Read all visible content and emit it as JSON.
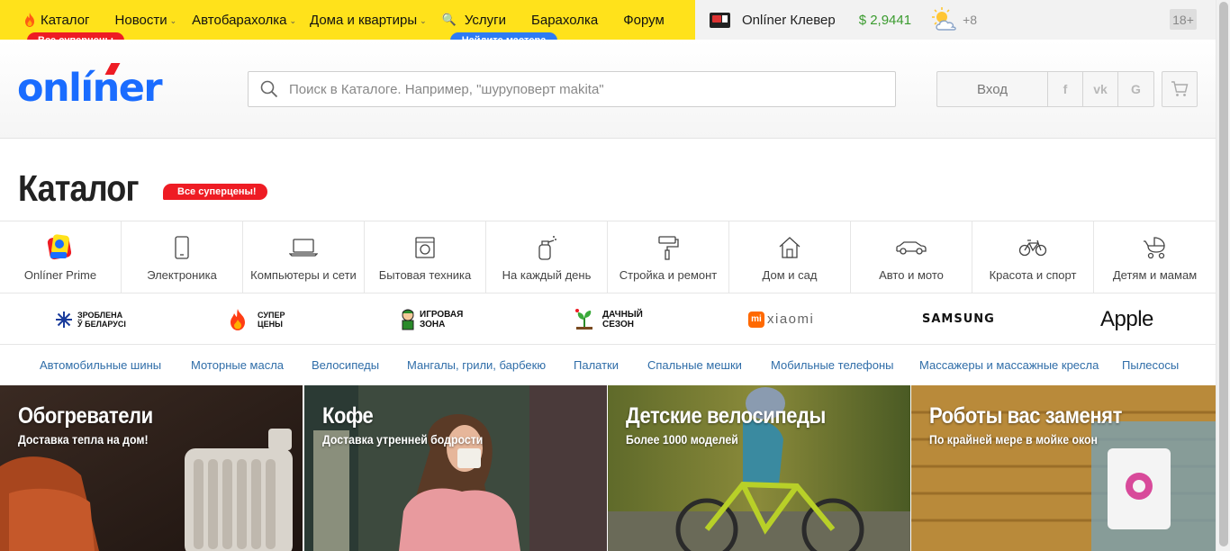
{
  "topnav": {
    "catalog": "Каталог",
    "news": "Новости",
    "auto": "Автобарахолка",
    "realty": "Дома и квартиры",
    "services": "Услуги",
    "baraholka": "Барахолка",
    "forum": "Форум",
    "catalog_badge": "Все суперцены",
    "services_badge": "Найдите мастера"
  },
  "topright": {
    "clever": "Onlíner Клевер",
    "rate": "$ 2,9441",
    "temp": "+8",
    "age": "18+"
  },
  "header": {
    "logo": "onlíner",
    "search_placeholder": "Поиск в Каталоге. Например, \"шуруповерт makita\"",
    "login": "Вход",
    "social": [
      "f",
      "vk",
      "G"
    ]
  },
  "catalog": {
    "title": "Каталог",
    "badge": "Все суперцены!"
  },
  "tiles": [
    {
      "label": "Onlíner Prime",
      "icon": "prime-icon"
    },
    {
      "label": "Электроника",
      "icon": "phone-icon"
    },
    {
      "label": "Компьютеры и сети",
      "icon": "laptop-icon"
    },
    {
      "label": "Бытовая техника",
      "icon": "washer-icon"
    },
    {
      "label": "На каждый день",
      "icon": "spray-icon"
    },
    {
      "label": "Стройка и ремонт",
      "icon": "roller-icon"
    },
    {
      "label": "Дом и сад",
      "icon": "house-icon"
    },
    {
      "label": "Авто и мото",
      "icon": "car-icon"
    },
    {
      "label": "Красота и спорт",
      "icon": "bicycle-icon"
    },
    {
      "label": "Детям и мамам",
      "icon": "stroller-icon"
    }
  ],
  "brands": {
    "belarus": [
      "Зроблена",
      "ў Беларусі"
    ],
    "super": [
      "Супер",
      "цены"
    ],
    "game": [
      "Игровая",
      "зона"
    ],
    "dacha": [
      "Дачный",
      "сезон"
    ],
    "xiaomi": "xiaomi",
    "samsung": "SAMSUNG",
    "apple": "Apple"
  },
  "links": [
    "Автомобильные шины",
    "Моторные масла",
    "Велосипеды",
    "Мангалы, грили, барбекю",
    "Палатки",
    "Спальные мешки",
    "Мобильные телефоны",
    "Массажеры и массажные кресла",
    "Пылесосы"
  ],
  "promos": [
    {
      "title": "Обогреватели",
      "subtitle": "Доставка тепла на дом!"
    },
    {
      "title": "Кофе",
      "subtitle": "Доставка утренней бодрости"
    },
    {
      "title": "Детские велосипеды",
      "subtitle": "Более 1000 моделей"
    },
    {
      "title": "Роботы вас заменят",
      "subtitle": "По крайней мере в мойке окон"
    }
  ],
  "colors": {
    "brand_blue": "#1a6cff",
    "top_yellow": "#ffe21b",
    "badge_red": "#ee1c24",
    "badge_blue": "#2d7bf4",
    "rate_green": "#3a9b2e",
    "link_blue": "#2f6da8"
  }
}
